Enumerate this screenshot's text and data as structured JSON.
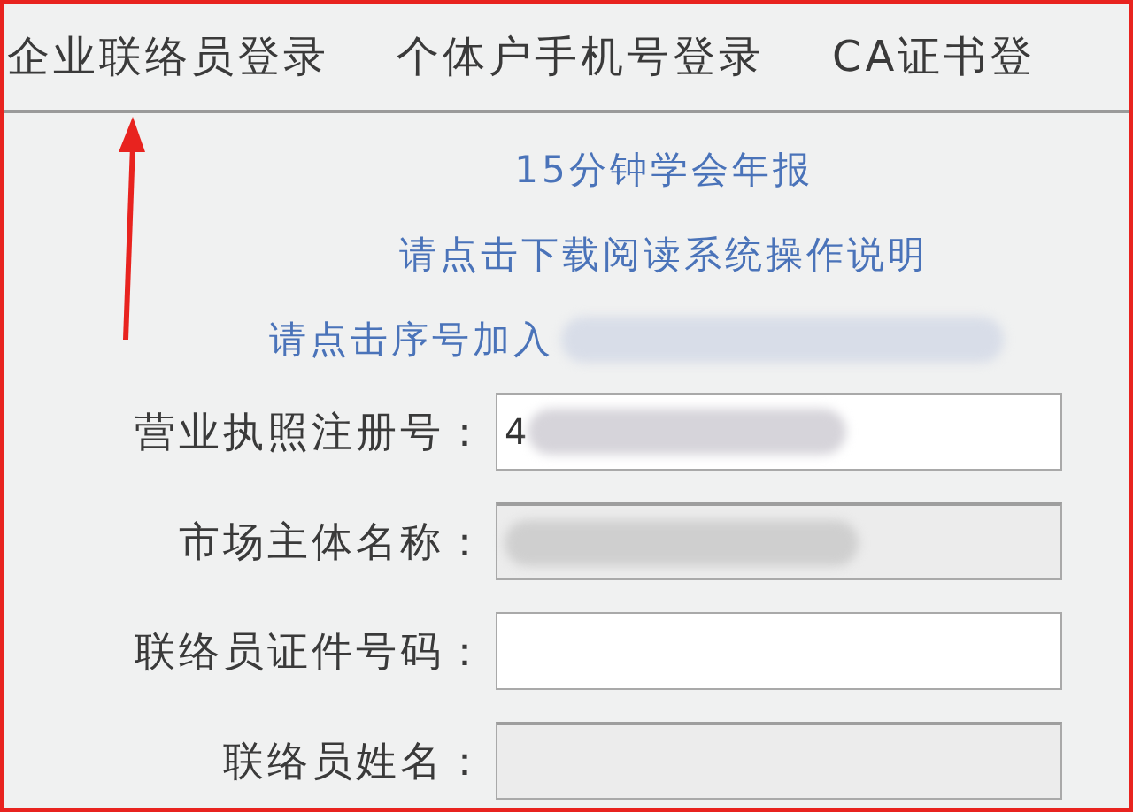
{
  "tabs": [
    {
      "label": "企业联络员登录"
    },
    {
      "label": "个体户手机号登录"
    },
    {
      "label": "CA证书登"
    }
  ],
  "links": [
    {
      "text": "15分钟学会年报",
      "redacted": false
    },
    {
      "text": "请点击下载阅读系统操作说明",
      "redacted": false
    },
    {
      "text": "请点击序号加入",
      "redacted": true
    }
  ],
  "form": [
    {
      "label": "营业执照注册号：",
      "value": "4",
      "redacted": true,
      "disabled": false
    },
    {
      "label": "市场主体名称：",
      "redacted": true,
      "disabled": true
    },
    {
      "label": "联络员证件号码：",
      "redacted": false,
      "disabled": false
    },
    {
      "label": "联络员姓名：",
      "redacted": false,
      "disabled": true
    }
  ]
}
